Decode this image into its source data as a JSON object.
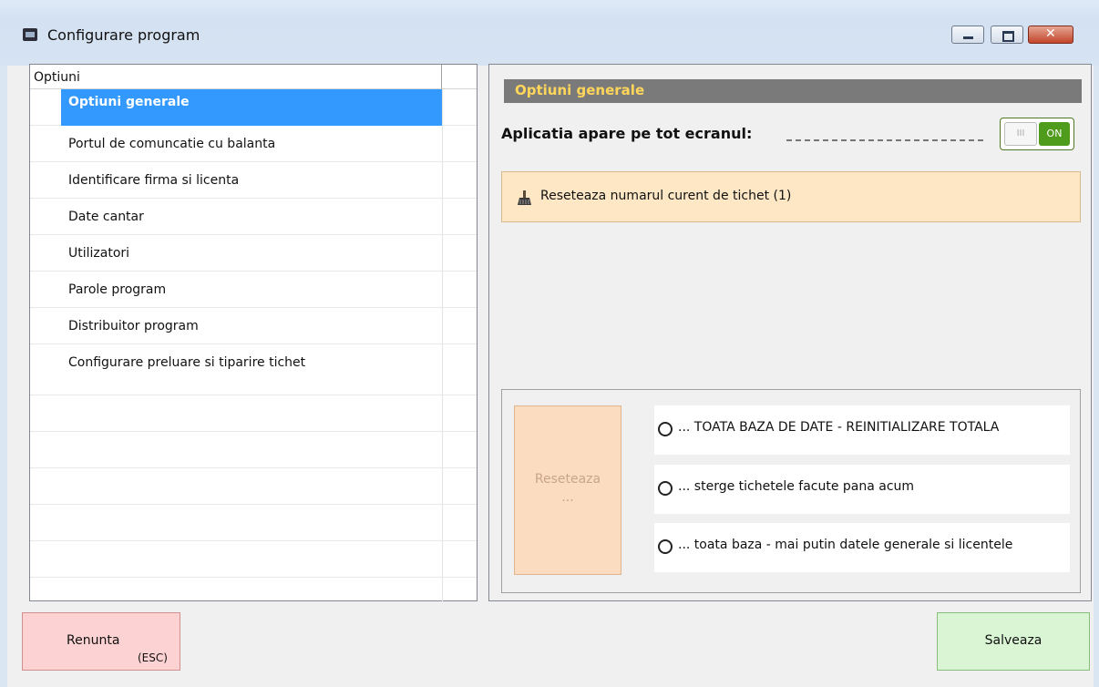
{
  "window": {
    "title": "Configurare program"
  },
  "left_list": {
    "header": "Optiuni",
    "items": [
      {
        "label": "Optiuni generale",
        "selected": true
      },
      {
        "label": "Portul de comuncatie cu balanta"
      },
      {
        "label": "Identificare firma si licenta"
      },
      {
        "label": "Date cantar"
      },
      {
        "label": "Utilizatori"
      },
      {
        "label": "Parole program"
      },
      {
        "label": "Distribuitor program"
      },
      {
        "label": "Configurare preluare si tiparire tichet"
      }
    ]
  },
  "right_panel": {
    "section_title": "Optiuni generale",
    "fullscreen_label": "Aplicatia apare pe tot ecranul:",
    "toggle": {
      "knob": "III",
      "state": "ON"
    },
    "reset_ticket_label": "Reseteaza numarul curent de tichet (1)",
    "reset_button": {
      "line1": "Reseteaza",
      "line2": "..."
    },
    "reset_options": [
      "... TOATA BAZA DE DATE - REINITIALIZARE TOTALA",
      "... sterge tichetele facute pana acum",
      "... toata baza - mai putin datele generale si licentele"
    ]
  },
  "buttons": {
    "cancel": {
      "label": "Renunta",
      "shortcut": "(ESC)"
    },
    "save": {
      "label": "Salveaza"
    }
  }
}
